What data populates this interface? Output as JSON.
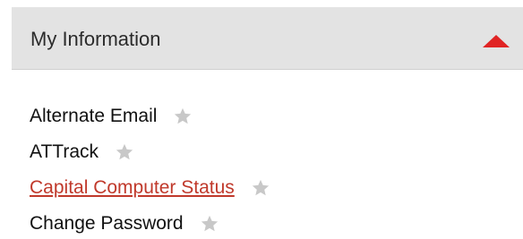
{
  "section": {
    "title": "My Information",
    "caret_icon": "triangle-up-icon",
    "caret_color": "#e02424",
    "expanded": true
  },
  "items": [
    {
      "label": "Alternate Email",
      "is_link": false,
      "icon": "star-icon"
    },
    {
      "label": "ATTrack",
      "is_link": false,
      "icon": "star-icon"
    },
    {
      "label": "Capital Computer Status",
      "is_link": true,
      "icon": "star-icon"
    },
    {
      "label": "Change Password",
      "is_link": false,
      "icon": "star-icon"
    }
  ],
  "colors": {
    "header_bg": "#e3e3e3",
    "link": "#c0392b",
    "star": "#c8c8c8"
  }
}
